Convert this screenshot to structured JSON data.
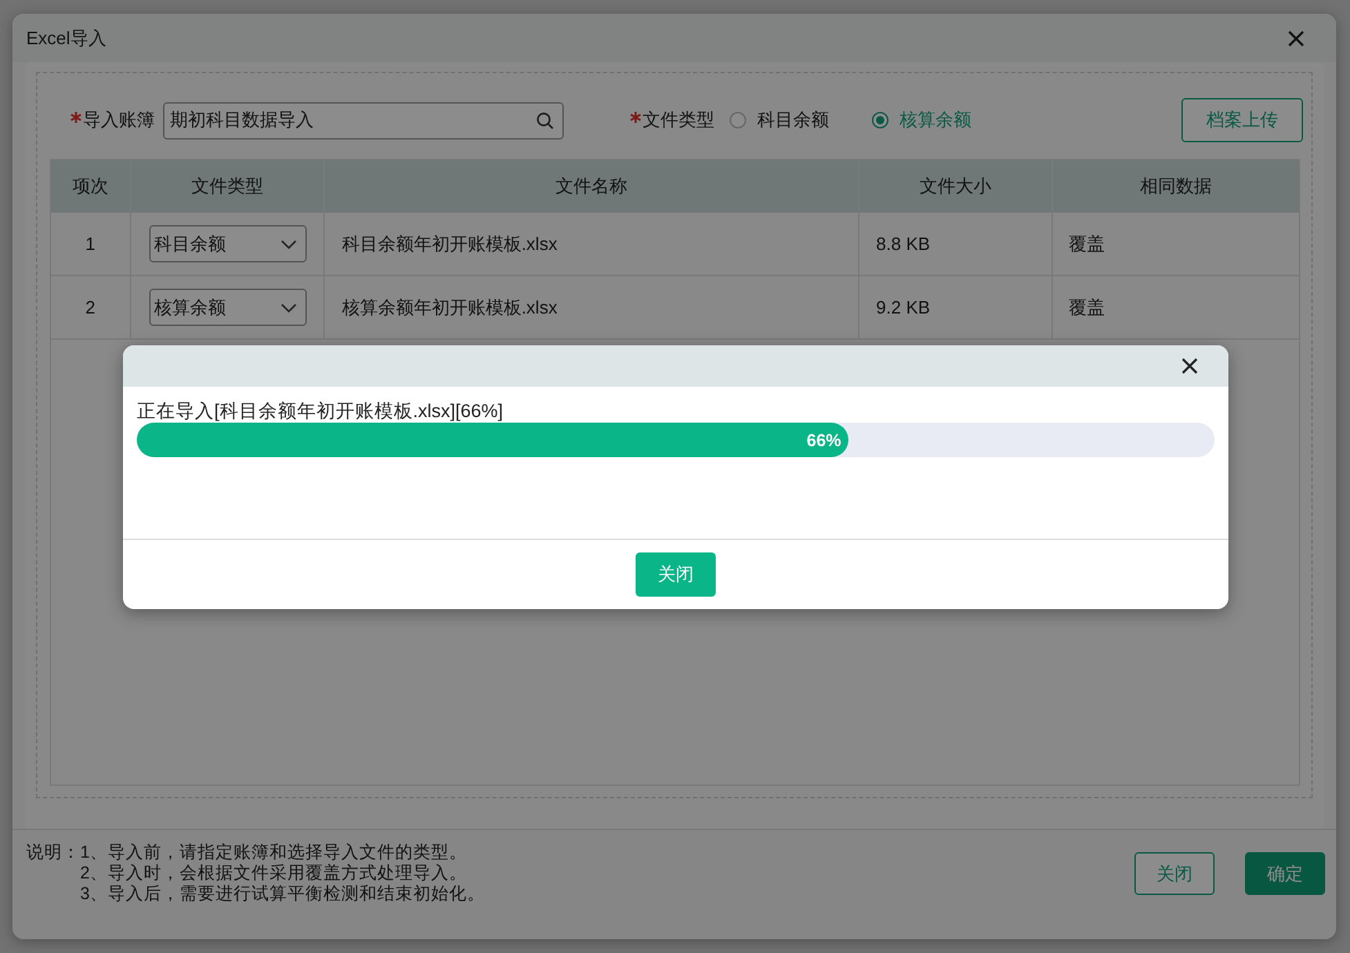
{
  "dialog": {
    "title": "Excel导入"
  },
  "form": {
    "ledger": {
      "label": "导入账簿",
      "required": true,
      "value": "期初科目数据导入"
    },
    "file_type": {
      "label": "文件类型",
      "required": true,
      "options": [
        {
          "label": "科目余额",
          "selected": false
        },
        {
          "label": "核算余额",
          "selected": true
        }
      ]
    },
    "upload_button": "档案上传"
  },
  "table": {
    "columns": [
      "项次",
      "文件类型",
      "文件名称",
      "文件大小",
      "相同数据"
    ],
    "rows": [
      {
        "index": "1",
        "file_type": "科目余额",
        "file_name": "科目余额年初开账模板.xlsx",
        "file_size": "8.8 KB",
        "duplicate": "覆盖"
      },
      {
        "index": "2",
        "file_type": "核算余额",
        "file_name": "核算余额年初开账模板.xlsx",
        "file_size": "9.2 KB",
        "duplicate": "覆盖"
      }
    ]
  },
  "notes": {
    "label": "说明：",
    "lines": [
      "1、导入前，请指定账簿和选择导入文件的类型。",
      "2、导入时，会根据文件采用覆盖方式处理导入。",
      "3、导入后，需要进行试算平衡检测和结束初始化。"
    ]
  },
  "footer_buttons": [
    {
      "label": "关闭",
      "kind": "secondary"
    },
    {
      "label": "确定",
      "kind": "primary"
    }
  ],
  "progress_dialog": {
    "message": "正在导入[科目余额年初开账模板.xlsx][66%]",
    "level": 0.66,
    "reading": "66%",
    "button": "关闭"
  }
}
